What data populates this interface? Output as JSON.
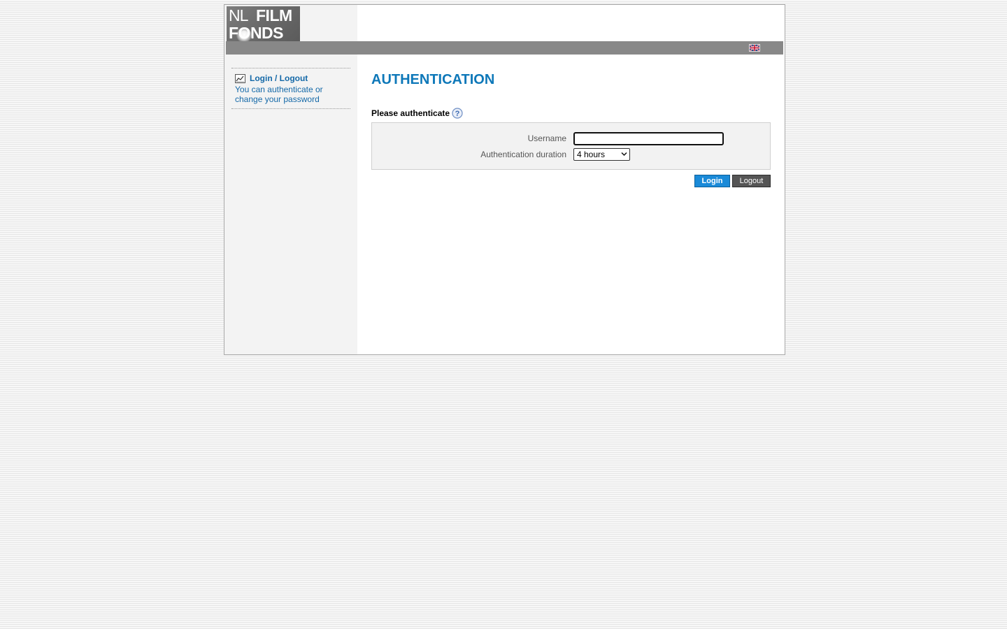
{
  "logo": {
    "line1_a": "NL",
    "line1_b": "FILM",
    "line2": "FONDS"
  },
  "topbar": {
    "language_flag_icon": "uk-flag-icon"
  },
  "sidebar": {
    "items": [
      {
        "icon": "chart-line-icon",
        "title": "Login / Logout",
        "description": "You can authenticate or change your password"
      }
    ]
  },
  "main": {
    "title": "AUTHENTICATION",
    "section_heading": "Please authenticate",
    "help_icon": "help-question-icon",
    "form": {
      "username_label": "Username",
      "username_value": "",
      "duration_label": "Authentication duration",
      "duration_selected": "4 hours"
    },
    "buttons": {
      "login_label": "Login",
      "logout_label": "Logout"
    }
  },
  "colors": {
    "accent": "#0e78b9",
    "link": "#1569a8",
    "login_button": "#1a8ad8",
    "logout_button": "#555555",
    "topbar": "#888888"
  }
}
